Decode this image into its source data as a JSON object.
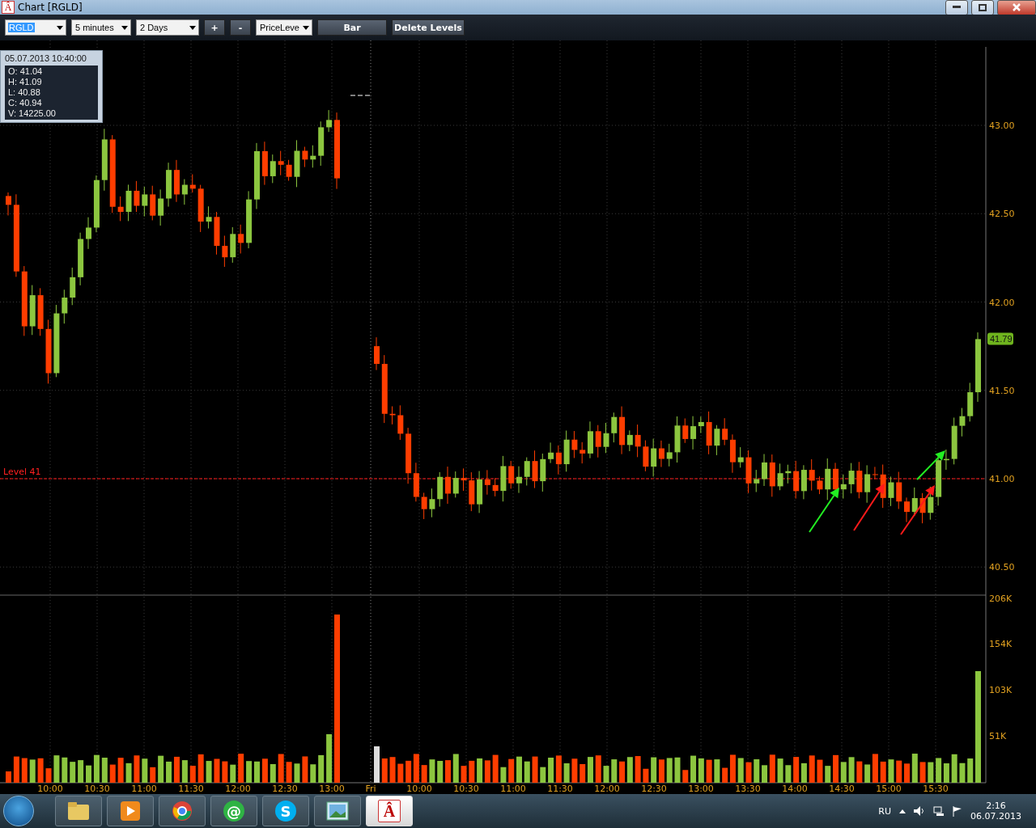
{
  "window": {
    "icon_glyph": "Â",
    "title": "Chart [RGLD]"
  },
  "toolbar": {
    "symbol": "RGLD",
    "interval": "5 minutes",
    "range": "2 Days",
    "zoom_in": "+",
    "zoom_out": "-",
    "tool": "PriceLeve",
    "buttons": [
      "Bar",
      "Delete Levels"
    ]
  },
  "info_box": {
    "datetime": "05.07.2013 10:40:00",
    "lines": [
      "O: 41.04",
      "H: 41.09",
      "L: 40.88",
      "C: 40.94",
      "V: 14225.00"
    ]
  },
  "price_axis": {
    "labels": [
      "43.00",
      "42.50",
      "42.00",
      "41.50",
      "41.00",
      "40.50"
    ],
    "current_price": "41.79"
  },
  "level_line": {
    "label": "Level 41"
  },
  "volume_axis": {
    "labels": [
      "206K",
      "154K",
      "103K",
      "51K"
    ]
  },
  "time_axis": {
    "labels": [
      "10:00",
      "10:30",
      "11:00",
      "11:30",
      "12:00",
      "12:30",
      "13:00",
      "Fri",
      "10:00",
      "10:30",
      "11:00",
      "11:30",
      "12:00",
      "12:30",
      "13:00",
      "13:30",
      "14:00",
      "14:30",
      "15:00",
      "15:30"
    ]
  },
  "taskbar": {
    "apps": [
      {
        "kind": "folder",
        "selected": false
      },
      {
        "kind": "media",
        "selected": false
      },
      {
        "kind": "browser",
        "selected": false
      },
      {
        "kind": "mail",
        "glyph": "@",
        "selected": false
      },
      {
        "kind": "skype",
        "glyph": "S",
        "selected": false
      },
      {
        "kind": "picture",
        "selected": false
      },
      {
        "kind": "app",
        "glyph": "Â",
        "selected": true
      }
    ],
    "language": "RU",
    "time": "2:16",
    "date": "06.07.2013"
  }
}
